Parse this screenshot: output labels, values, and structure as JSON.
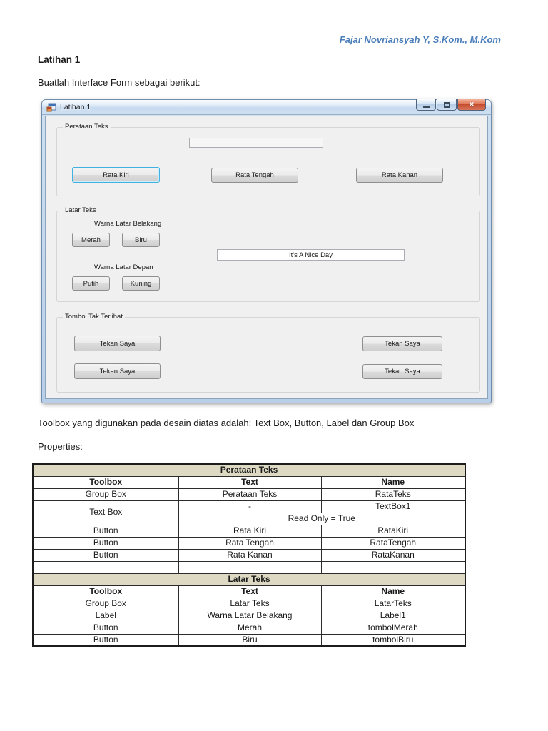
{
  "document": {
    "author_header": "Fajar Novriansyah Y, S.Kom., M.Kom",
    "title": "Latihan 1",
    "intro": "Buatlah Interface Form sebagai berikut:",
    "toolbox_note": "Toolbox yang digunakan pada desain diatas adalah: Text Box, Button, Label dan Group Box",
    "properties_label": "Properties:"
  },
  "form_window": {
    "title": "Latihan 1",
    "perataan_teks": {
      "label": "Perataan Teks",
      "textbox_value": "",
      "buttons": [
        "Rata Kiri",
        "Rata Tengah",
        "Rata Kanan"
      ]
    },
    "latar_teks": {
      "label": "Latar Teks",
      "bg_label": "Warna Latar Belakang",
      "bg_buttons": [
        "Merah",
        "Biru"
      ],
      "textbox_value": "It's A Nice Day",
      "fg_label": "Warna Latar Depan",
      "fg_buttons": [
        "Putih",
        "Kuning"
      ]
    },
    "tombol_tak_terlihat": {
      "label": "Tombol Tak Terlihat",
      "buttons": [
        "Tekan Saya",
        "Tekan Saya",
        "Tekan Saya",
        "Tekan Saya"
      ]
    }
  },
  "properties_table": {
    "section1": {
      "title": "Perataan Teks",
      "columns": [
        "Toolbox",
        "Text",
        "Name"
      ],
      "row_groupbox": {
        "toolbox": "Group Box",
        "text": "Perataan Teks",
        "name": "RataTeks"
      },
      "row_textbox": {
        "toolbox": "Text Box",
        "text": "-",
        "name": "TextBox1",
        "property_note": "Read Only = True"
      },
      "row_rata_kiri": {
        "toolbox": "Button",
        "text": "Rata Kiri",
        "name": "RataKiri"
      },
      "row_rata_tengah": {
        "toolbox": "Button",
        "text": "Rata Tengah",
        "name": "RataTengah"
      },
      "row_rata_kanan": {
        "toolbox": "Button",
        "text": "Rata Kanan",
        "name": "RataKanan"
      }
    },
    "section2": {
      "title": "Latar Teks",
      "columns": [
        "Toolbox",
        "Text",
        "Name"
      ],
      "row_groupbox": {
        "toolbox": "Group Box",
        "text": "Latar Teks",
        "name": "LatarTeks"
      },
      "row_label": {
        "toolbox": "Label",
        "text": "Warna Latar Belakang",
        "name": "Label1"
      },
      "row_merah": {
        "toolbox": "Button",
        "text": "Merah",
        "name": "tombolMerah"
      },
      "row_biru": {
        "toolbox": "Button",
        "text": "Biru",
        "name": "tombolBiru"
      }
    }
  },
  "colors": {
    "author_blue": "#4a7ebb",
    "table_section_bg": "#ddd9c3",
    "close_button_red": "#c34a2c",
    "focused_button_border": "#41b1e1",
    "client_background": "#f0f0f0"
  }
}
